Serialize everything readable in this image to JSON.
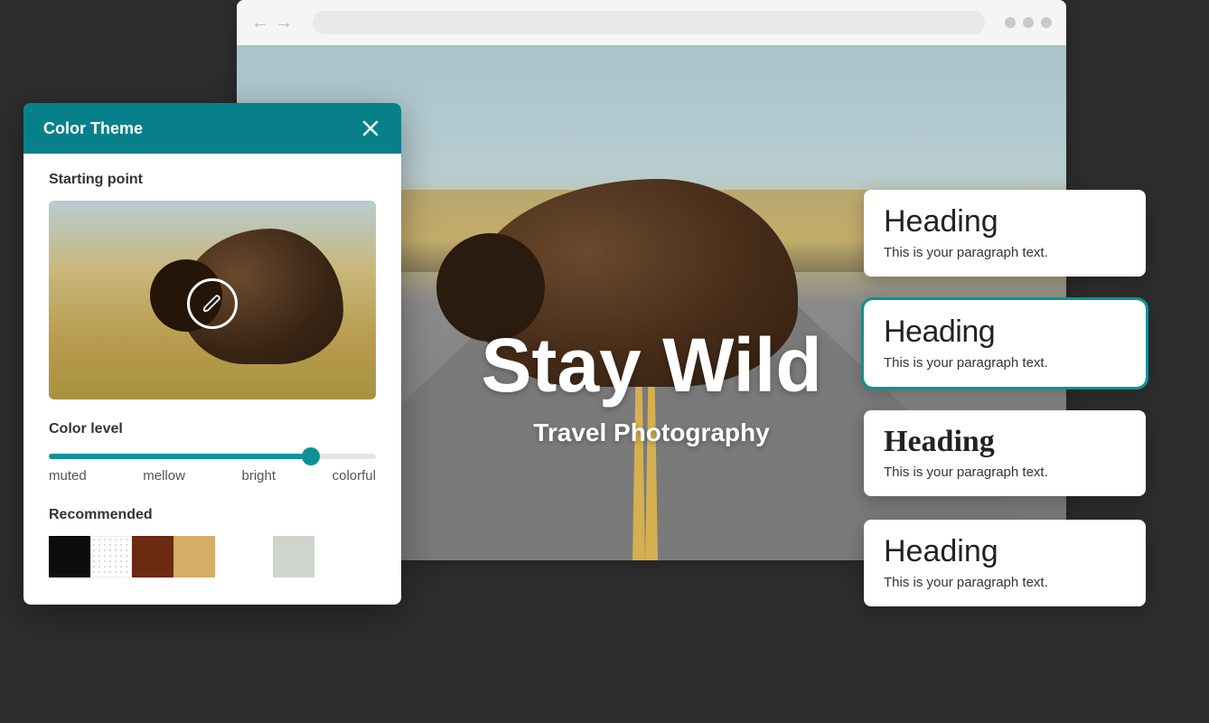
{
  "browser": {
    "hero_title": "Stay Wild",
    "hero_subtitle": "Travel Photography"
  },
  "panel": {
    "title": "Color Theme",
    "starting_label": "Starting point",
    "color_level_label": "Color level",
    "slider_labels": [
      "muted",
      "mellow",
      "bright",
      "colorful"
    ],
    "recommended_label": "Recommended",
    "swatches": [
      "#0f0d0b",
      "dotted",
      "#6b2a12",
      "#d3ae64",
      "#cfd4cc"
    ]
  },
  "font_cards": [
    {
      "heading": "Heading",
      "paragraph": "This is your paragraph text.",
      "selected": false
    },
    {
      "heading": "Heading",
      "paragraph": "This is your paragraph text.",
      "selected": true
    },
    {
      "heading": "Heading",
      "paragraph": "This is your paragraph text.",
      "selected": false
    },
    {
      "heading": "Heading",
      "paragraph": "This is your paragraph text.",
      "selected": false
    }
  ],
  "colors": {
    "accent": "#0f9199",
    "panel_head": "#08808a"
  }
}
